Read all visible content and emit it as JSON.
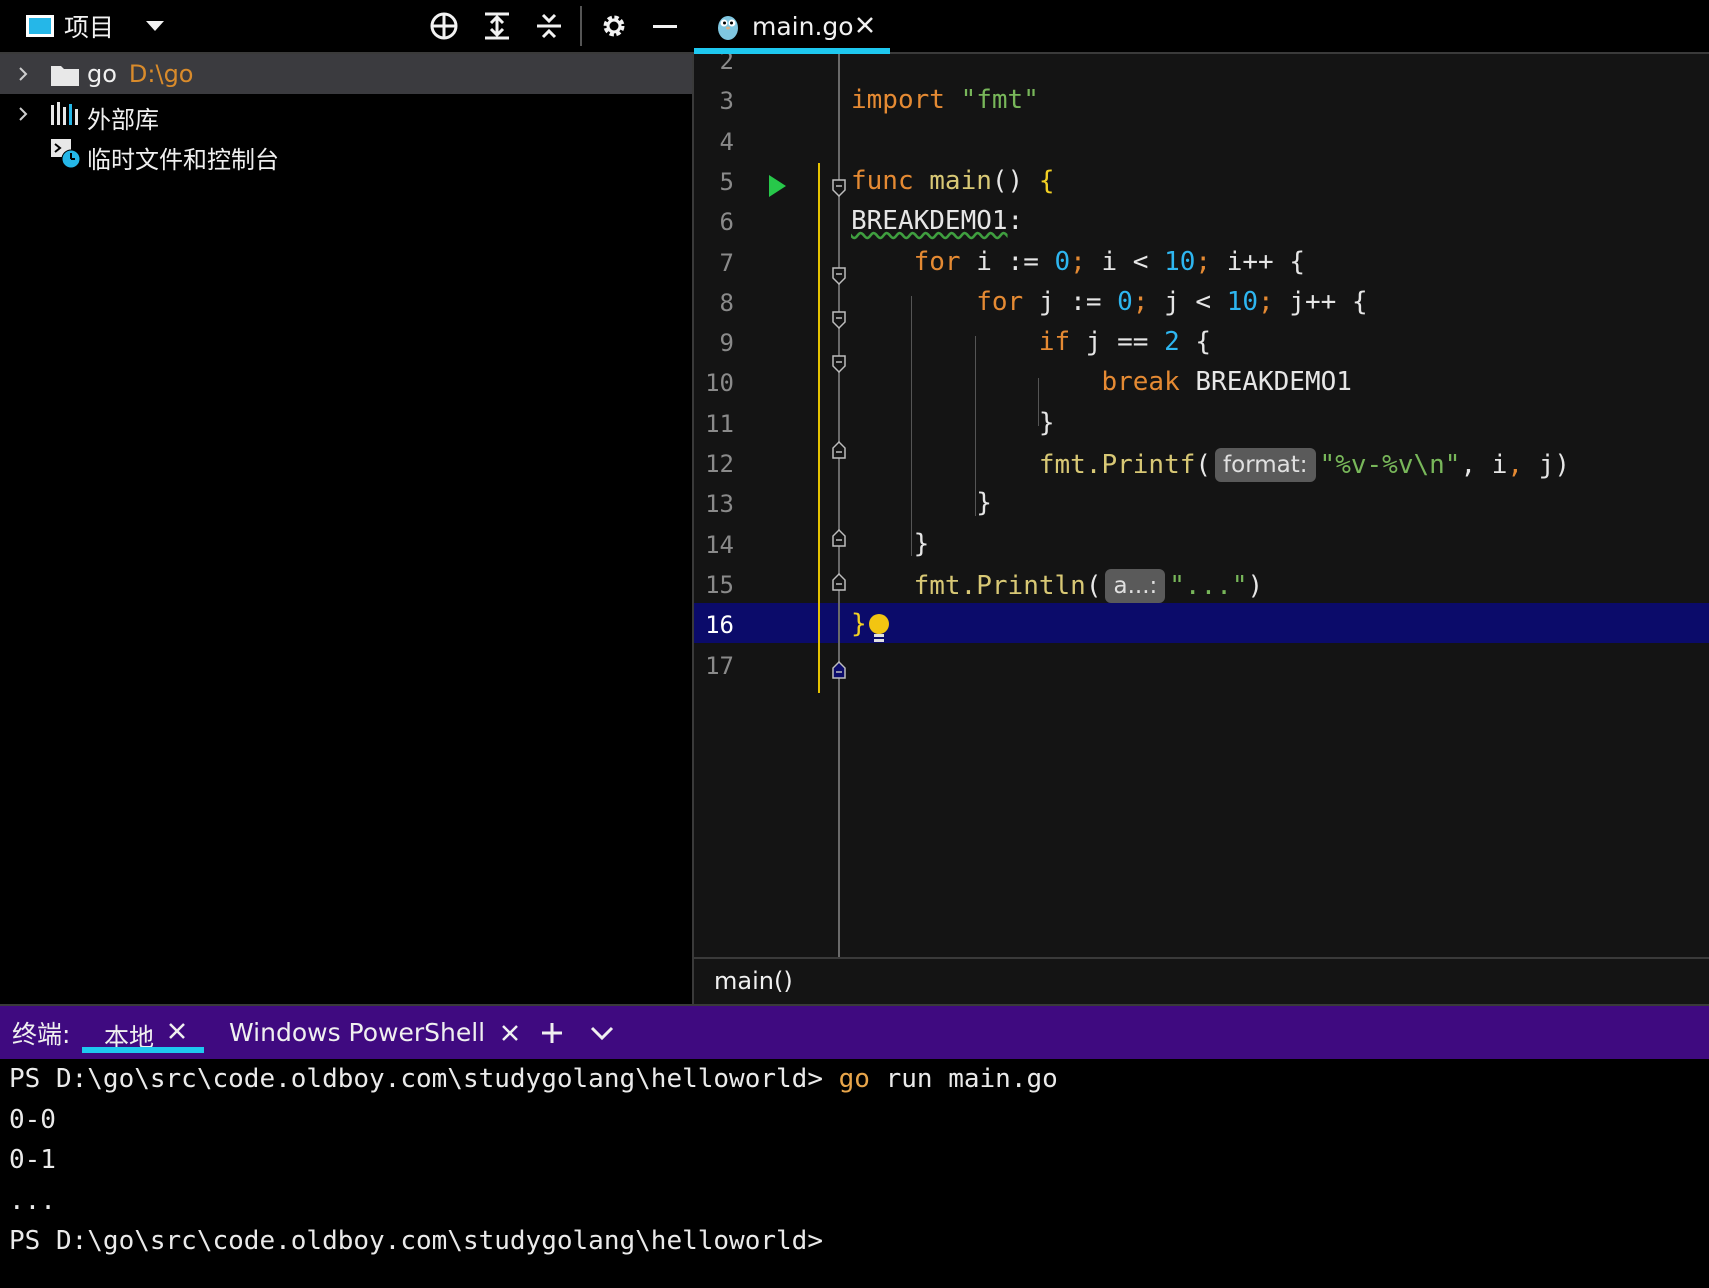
{
  "project_panel": {
    "title": "项目",
    "tree": [
      {
        "name": "go",
        "path": "D:\\go",
        "expandable": true,
        "selected": true
      },
      {
        "name": "外部库",
        "expandable": true,
        "selected": false
      },
      {
        "name": "临时文件和控制台",
        "expandable": false,
        "selected": false
      }
    ]
  },
  "editor": {
    "tab": {
      "label": "main.go"
    },
    "code_lines": [
      {
        "num": "2",
        "tokens": []
      },
      {
        "num": "3",
        "tokens": [
          {
            "t": "import",
            "c": "kw"
          },
          {
            "t": " "
          },
          {
            "t": "\"fmt\"",
            "c": "str"
          }
        ]
      },
      {
        "num": "4",
        "tokens": []
      },
      {
        "num": "5",
        "tokens": [
          {
            "t": "func",
            "c": "kw"
          },
          {
            "t": " "
          },
          {
            "t": "main",
            "c": "fn"
          },
          {
            "t": "() "
          },
          {
            "t": "{",
            "c": "brace-y"
          }
        ]
      },
      {
        "num": "6",
        "tokens": [
          {
            "t": "BREAKDEMO1",
            "c": "sq"
          },
          {
            "t": ":"
          }
        ]
      },
      {
        "num": "7",
        "tokens": [
          {
            "t": "    "
          },
          {
            "t": "for",
            "c": "kw"
          },
          {
            "t": " i := "
          },
          {
            "t": "0",
            "c": "num"
          },
          {
            "t": ";",
            "c": "kw"
          },
          {
            "t": " i < "
          },
          {
            "t": "10",
            "c": "num"
          },
          {
            "t": ";",
            "c": "kw"
          },
          {
            "t": " i++ {"
          }
        ]
      },
      {
        "num": "8",
        "tokens": [
          {
            "t": "        "
          },
          {
            "t": "for",
            "c": "kw"
          },
          {
            "t": " j := "
          },
          {
            "t": "0",
            "c": "num"
          },
          {
            "t": ";",
            "c": "kw"
          },
          {
            "t": " j < "
          },
          {
            "t": "10",
            "c": "num"
          },
          {
            "t": ";",
            "c": "kw"
          },
          {
            "t": " j++ {"
          }
        ]
      },
      {
        "num": "9",
        "tokens": [
          {
            "t": "            "
          },
          {
            "t": "if",
            "c": "kw"
          },
          {
            "t": " j == "
          },
          {
            "t": "2",
            "c": "num"
          },
          {
            "t": " {"
          }
        ]
      },
      {
        "num": "10",
        "tokens": [
          {
            "t": "                "
          },
          {
            "t": "break",
            "c": "kw"
          },
          {
            "t": " BREAKDEMO1"
          }
        ]
      },
      {
        "num": "11",
        "tokens": [
          {
            "t": "            }"
          }
        ]
      },
      {
        "num": "12",
        "tokens": [
          {
            "t": "            "
          },
          {
            "t": "fmt.",
            "c": "fn"
          },
          {
            "t": "Printf",
            "c": "fn"
          },
          {
            "t": "("
          },
          {
            "hint": "format:"
          },
          {
            "t": "\"%v-%v\\n\"",
            "c": "str"
          },
          {
            "t": ", i"
          },
          {
            "t": ",",
            "c": "kw"
          },
          {
            "t": " j)"
          }
        ]
      },
      {
        "num": "13",
        "tokens": [
          {
            "t": "        }"
          }
        ]
      },
      {
        "num": "14",
        "tokens": [
          {
            "t": "    }"
          }
        ]
      },
      {
        "num": "15",
        "tokens": [
          {
            "t": "    "
          },
          {
            "t": "fmt.",
            "c": "fn"
          },
          {
            "t": "Println",
            "c": "fn"
          },
          {
            "t": "("
          },
          {
            "hint": "a...:"
          },
          {
            "t": "\"...\"",
            "c": "str"
          },
          {
            "t": ")"
          }
        ]
      },
      {
        "num": "16",
        "tokens": [
          {
            "t": "}",
            "c": "brace-y"
          }
        ],
        "current": true
      },
      {
        "num": "17",
        "tokens": []
      }
    ],
    "breadcrumb": "main()"
  },
  "terminal": {
    "title": "终端:",
    "tabs": [
      {
        "label": "本地",
        "active": true
      },
      {
        "label": "Windows PowerShell",
        "active": false
      }
    ],
    "lines": [
      {
        "prompt": "PS D:\\go\\src\\code.oldboy.com\\studygolang\\helloworld> ",
        "command": "go",
        "rest": " run main.go"
      },
      {
        "text": "0-0"
      },
      {
        "text": "0-1"
      },
      {
        "text": "..."
      },
      {
        "prompt": "PS D:\\go\\src\\code.oldboy.com\\studygolang\\helloworld>",
        "command": "",
        "rest": ""
      }
    ]
  },
  "colors": {
    "accent_cyan": "#1ec8f0",
    "terminal_header": "#3f0a80",
    "current_line": "#0b0b6a",
    "keyword": "#e58a33",
    "string": "#78b75a",
    "number": "#2eb6f0"
  },
  "icons": [
    "project-icon",
    "dropdown-icon",
    "locate-icon",
    "expand-all-icon",
    "collapse-all-icon",
    "gear-icon",
    "minimize-icon",
    "folder-icon",
    "library-icon",
    "scratch-icon",
    "gopher-icon",
    "close-icon",
    "run-icon",
    "bulb-icon",
    "add-icon",
    "chevron-down-icon"
  ]
}
